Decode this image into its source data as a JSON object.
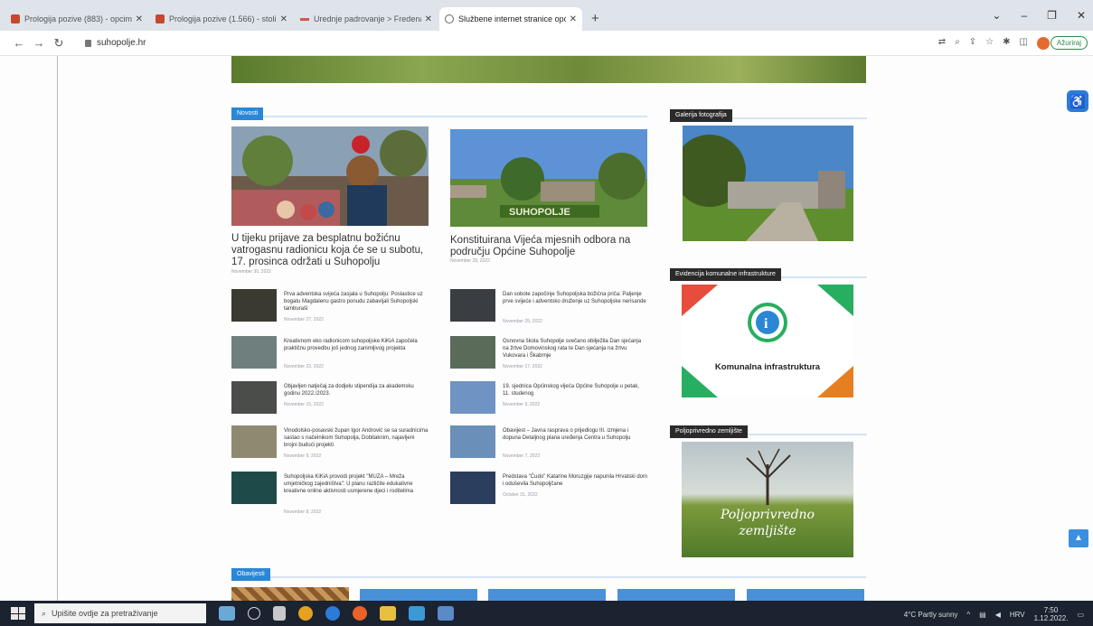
{
  "browser": {
    "tabs": [
      {
        "title": "Prologija pozive (883) - opcimanet",
        "fav": "hv"
      },
      {
        "title": "Prologija pozive (1.566) - stoli180",
        "fav": "hv"
      },
      {
        "title": "Urednje padrovanje > Fredenati",
        "fav": "red"
      },
      {
        "title": "Službene internet stranice općin",
        "fav": "globe",
        "active": true
      }
    ],
    "new_tab": "+",
    "url": "suhopolje.hr",
    "profile_label": "Ažuriraj"
  },
  "sections": {
    "news_tag": "Novosti",
    "gallery_tag": "Galerija fotografija",
    "komunalna_tag": "Evidencija komunalne infrastrukture",
    "polj_tag": "Poljoprivredno zemljište",
    "bottom_tag": "Obavijesti"
  },
  "hero": [
    {
      "title": "U tijeku prijave za besplatnu božićnu vatrogasnu radionicu koja će se u subotu, 17. prosinca održati u Suhopolju",
      "date": "November 30, 2022"
    },
    {
      "title": "Konstituirana Vijeća mjesnih odbora na području Općine Suhopolje",
      "date": "November 28, 2022"
    }
  ],
  "news_left": [
    {
      "title": "Prva adventska svijeća zasjala u Suhopolju: Poslastice uz bogatu Magdalenu gastro ponudu zabavljali Suhopoljski tamburaši",
      "date": "November 27, 2022"
    },
    {
      "title": "Kreativnom eko radionicom suhopoljske KiKiA započela praktičnu provedbu još jednog zanimljivog projekta",
      "date": "November 22, 2022"
    },
    {
      "title": "Objavljen natječaj za dodjelu stipendija za akademsku godinu 2022./2023.",
      "date": "November 15, 2022"
    },
    {
      "title": "Vinodolsko-posavski župan Igor Andrović se sa suradnicima sastao s načelnikom Suhopolja, Dobitaknim, najavljeni brojni budući projekti",
      "date": "November 9, 2022"
    },
    {
      "title": "Suhopoljska KiKiA provodi projekt \"MUZA – Mreža umjetničkog zajedništva\": U planu različite edukativne kreativne online aktivnosti usmjerene djeci i roditelima",
      "date": "November 8, 2022"
    }
  ],
  "news_right": [
    {
      "title": "Dan sobote započinje Suhopoljska božićna priča: Paljenje prve svijeće i adventsko druženje uz Suhopoljske nerisande",
      "date": "November 25, 2022"
    },
    {
      "title": "Osnovna škola Suhopolje svečano obilježila Dan sjećanja na žrtve Domovinskog rata te Dan sjećanja na žrtvu Vukovara i Škabrnje",
      "date": "November 17, 2022"
    },
    {
      "title": "19. sjednica Općinskog vijeća Općine Suhopolje u petak, 11. studenog",
      "date": "November 9, 2022"
    },
    {
      "title": "Obavijest – Javna rasprava o prijedlogu III. izmjena i dopuna Detaljnog plana uređenja Centra u Suhopolju",
      "date": "November 7, 2022"
    },
    {
      "title": "Predstava \"Ćudo\" Katarine Moruzgije napunila Hrvatski dom i oduševila Suhopoljčane",
      "date": "October 31, 2022"
    }
  ],
  "komunalna_label": "Komunalna infrastruktura",
  "polj_text_1": "Poljoprivredno",
  "polj_text_2": "zemljište",
  "taskbar": {
    "search_placeholder": "Upišite ovdje za pretraživanje",
    "weather": "4°C Partly sunny",
    "lang": "HRV",
    "time": "7:50",
    "date": "1.12.2022."
  },
  "colors": {
    "accent": "#2b87d6",
    "dark_tag": "#2a2a2a"
  }
}
